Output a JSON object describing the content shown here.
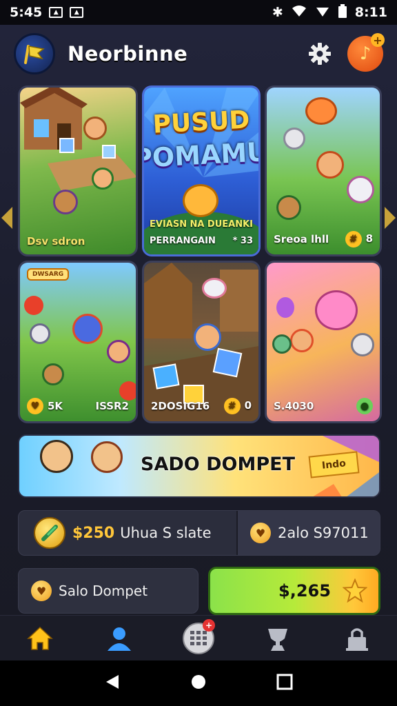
{
  "status_bar": {
    "time_left": "5:45",
    "time_right": "8:11"
  },
  "header": {
    "title": "Neorbinne"
  },
  "cards": [
    {
      "caption_left": "Dsv sdron",
      "caption_right": ""
    },
    {
      "promo_top": "PUSUD",
      "promo_bottom": "POMAMU!",
      "sub_left": "EVIASN",
      "sub_mid": "NA DUEANKI",
      "sub2_left": "PERRANGAIN",
      "sub2_right": "* 33"
    },
    {
      "caption_left": "Sreoa lhll",
      "caption_right": "8"
    },
    {
      "tag": "DWSARG",
      "caption_left": "5K",
      "caption_right": "ISSR2"
    },
    {
      "caption_left": "2DOSIG16",
      "caption_right": "0"
    },
    {
      "caption_left": "S.4030",
      "caption_right": ""
    }
  ],
  "banner": {
    "title": "SADO DOMPET",
    "flag": "Indo"
  },
  "balance": {
    "amount": "$250",
    "label": "Uhua S slate",
    "right_value": "2alo S97011"
  },
  "wallet": {
    "label": "Salo Dompet"
  },
  "cash": {
    "value": "$,265"
  },
  "nav": {
    "badge_count": "+"
  },
  "colors": {
    "accent_green": "#8be24a",
    "accent_gold": "#ffc63a",
    "bg_dark": "#1a1c2a"
  }
}
